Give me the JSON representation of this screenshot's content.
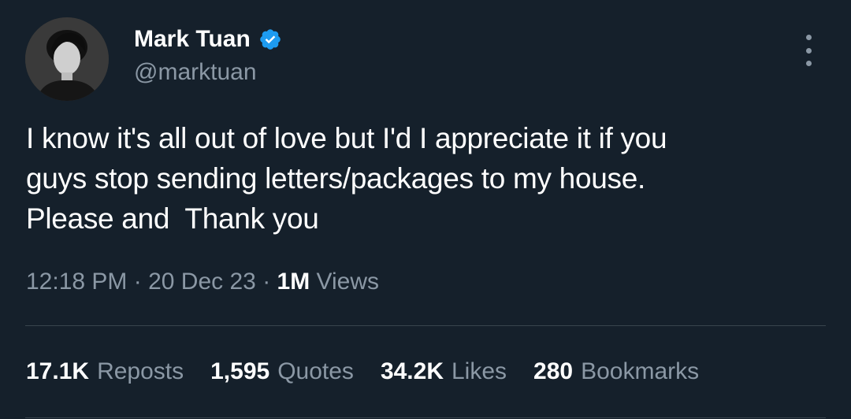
{
  "author": {
    "display_name": "Mark Tuan",
    "handle": "@marktuan",
    "verified": true,
    "verified_color": "#1d9bf0",
    "avatar_icon": "profile-photo"
  },
  "tweet": {
    "text": "I know it's all out of love but I'd I appreciate it if you\nguys stop sending letters/packages to my house.\nPlease and  Thank you"
  },
  "meta": {
    "time": "12:18 PM",
    "separator": " · ",
    "date": "20 Dec 23",
    "views_count": "1M",
    "views_label": " Views"
  },
  "stats": [
    {
      "count": "17.1K",
      "label": "Reposts"
    },
    {
      "count": "1,595",
      "label": "Quotes"
    },
    {
      "count": "34.2K",
      "label": "Likes"
    },
    {
      "count": "280",
      "label": "Bookmarks"
    }
  ],
  "colors": {
    "background": "#15202b",
    "secondary_text": "#8b98a5",
    "divider": "#38444d"
  }
}
